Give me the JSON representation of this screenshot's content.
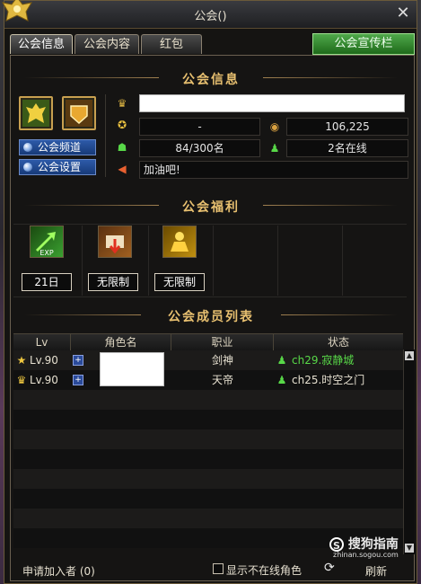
{
  "window": {
    "title": "公会()"
  },
  "tabs": [
    {
      "label": "公会信息",
      "active": true
    },
    {
      "label": "公会内容",
      "active": false
    },
    {
      "label": "红包",
      "active": false
    }
  ],
  "promo_button": "公会宣传栏",
  "sections": {
    "info": "公会信息",
    "benefits": "公会福利",
    "members": "公会成员列表"
  },
  "info": {
    "name": "",
    "rank": "-",
    "fund": "106,225",
    "members": "84/300名",
    "online": "2名在线",
    "notice": "加油吧!"
  },
  "buttons": {
    "channel": "公会频道",
    "settings": "公会设置"
  },
  "benefits": [
    {
      "label": "21日",
      "icon": "exp-boost-icon"
    },
    {
      "label": "无限制",
      "icon": "repair-icon"
    },
    {
      "label": "无限制",
      "icon": "character-buff-icon"
    }
  ],
  "member_table": {
    "headers": [
      "Lv",
      "角色名",
      "职业",
      "状态"
    ],
    "rows": [
      {
        "level": "Lv.90",
        "name": "",
        "job": "剑神",
        "status": "ch29.寂静城",
        "status_color": "#58d848",
        "rank_icon": "star-icon"
      },
      {
        "level": "Lv.90",
        "name": "",
        "job": "天帝",
        "status": "ch25.时空之门",
        "status_color": "#e6e0d0",
        "rank_icon": "crown-icon"
      }
    ]
  },
  "footer": {
    "apply": "申请加入者 (0)",
    "show_offline": "显示不在线角色",
    "refresh": "刷新",
    "watermark": "搜狗指南",
    "watermark_url": "zhinan.sogou.com"
  },
  "colors": {
    "accent_gold": "#e8c070",
    "online_green": "#58d848",
    "promo_green": "#2f8a2a"
  }
}
